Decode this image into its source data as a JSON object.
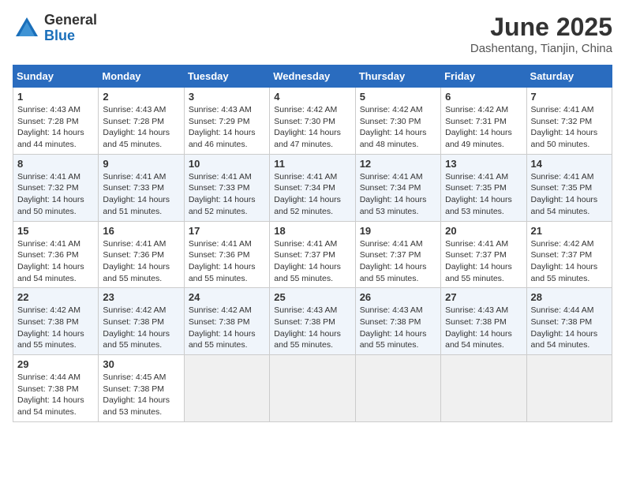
{
  "logo": {
    "general": "General",
    "blue": "Blue"
  },
  "title": "June 2025",
  "subtitle": "Dashentang, Tianjin, China",
  "days_of_week": [
    "Sunday",
    "Monday",
    "Tuesday",
    "Wednesday",
    "Thursday",
    "Friday",
    "Saturday"
  ],
  "weeks": [
    [
      {
        "day": "1",
        "info": "Sunrise: 4:43 AM\nSunset: 7:28 PM\nDaylight: 14 hours\nand 44 minutes."
      },
      {
        "day": "2",
        "info": "Sunrise: 4:43 AM\nSunset: 7:28 PM\nDaylight: 14 hours\nand 45 minutes."
      },
      {
        "day": "3",
        "info": "Sunrise: 4:43 AM\nSunset: 7:29 PM\nDaylight: 14 hours\nand 46 minutes."
      },
      {
        "day": "4",
        "info": "Sunrise: 4:42 AM\nSunset: 7:30 PM\nDaylight: 14 hours\nand 47 minutes."
      },
      {
        "day": "5",
        "info": "Sunrise: 4:42 AM\nSunset: 7:30 PM\nDaylight: 14 hours\nand 48 minutes."
      },
      {
        "day": "6",
        "info": "Sunrise: 4:42 AM\nSunset: 7:31 PM\nDaylight: 14 hours\nand 49 minutes."
      },
      {
        "day": "7",
        "info": "Sunrise: 4:41 AM\nSunset: 7:32 PM\nDaylight: 14 hours\nand 50 minutes."
      }
    ],
    [
      {
        "day": "8",
        "info": "Sunrise: 4:41 AM\nSunset: 7:32 PM\nDaylight: 14 hours\nand 50 minutes."
      },
      {
        "day": "9",
        "info": "Sunrise: 4:41 AM\nSunset: 7:33 PM\nDaylight: 14 hours\nand 51 minutes."
      },
      {
        "day": "10",
        "info": "Sunrise: 4:41 AM\nSunset: 7:33 PM\nDaylight: 14 hours\nand 52 minutes."
      },
      {
        "day": "11",
        "info": "Sunrise: 4:41 AM\nSunset: 7:34 PM\nDaylight: 14 hours\nand 52 minutes."
      },
      {
        "day": "12",
        "info": "Sunrise: 4:41 AM\nSunset: 7:34 PM\nDaylight: 14 hours\nand 53 minutes."
      },
      {
        "day": "13",
        "info": "Sunrise: 4:41 AM\nSunset: 7:35 PM\nDaylight: 14 hours\nand 53 minutes."
      },
      {
        "day": "14",
        "info": "Sunrise: 4:41 AM\nSunset: 7:35 PM\nDaylight: 14 hours\nand 54 minutes."
      }
    ],
    [
      {
        "day": "15",
        "info": "Sunrise: 4:41 AM\nSunset: 7:36 PM\nDaylight: 14 hours\nand 54 minutes."
      },
      {
        "day": "16",
        "info": "Sunrise: 4:41 AM\nSunset: 7:36 PM\nDaylight: 14 hours\nand 55 minutes."
      },
      {
        "day": "17",
        "info": "Sunrise: 4:41 AM\nSunset: 7:36 PM\nDaylight: 14 hours\nand 55 minutes."
      },
      {
        "day": "18",
        "info": "Sunrise: 4:41 AM\nSunset: 7:37 PM\nDaylight: 14 hours\nand 55 minutes."
      },
      {
        "day": "19",
        "info": "Sunrise: 4:41 AM\nSunset: 7:37 PM\nDaylight: 14 hours\nand 55 minutes."
      },
      {
        "day": "20",
        "info": "Sunrise: 4:41 AM\nSunset: 7:37 PM\nDaylight: 14 hours\nand 55 minutes."
      },
      {
        "day": "21",
        "info": "Sunrise: 4:42 AM\nSunset: 7:37 PM\nDaylight: 14 hours\nand 55 minutes."
      }
    ],
    [
      {
        "day": "22",
        "info": "Sunrise: 4:42 AM\nSunset: 7:38 PM\nDaylight: 14 hours\nand 55 minutes."
      },
      {
        "day": "23",
        "info": "Sunrise: 4:42 AM\nSunset: 7:38 PM\nDaylight: 14 hours\nand 55 minutes."
      },
      {
        "day": "24",
        "info": "Sunrise: 4:42 AM\nSunset: 7:38 PM\nDaylight: 14 hours\nand 55 minutes."
      },
      {
        "day": "25",
        "info": "Sunrise: 4:43 AM\nSunset: 7:38 PM\nDaylight: 14 hours\nand 55 minutes."
      },
      {
        "day": "26",
        "info": "Sunrise: 4:43 AM\nSunset: 7:38 PM\nDaylight: 14 hours\nand 55 minutes."
      },
      {
        "day": "27",
        "info": "Sunrise: 4:43 AM\nSunset: 7:38 PM\nDaylight: 14 hours\nand 54 minutes."
      },
      {
        "day": "28",
        "info": "Sunrise: 4:44 AM\nSunset: 7:38 PM\nDaylight: 14 hours\nand 54 minutes."
      }
    ],
    [
      {
        "day": "29",
        "info": "Sunrise: 4:44 AM\nSunset: 7:38 PM\nDaylight: 14 hours\nand 54 minutes."
      },
      {
        "day": "30",
        "info": "Sunrise: 4:45 AM\nSunset: 7:38 PM\nDaylight: 14 hours\nand 53 minutes."
      },
      {
        "day": "",
        "info": ""
      },
      {
        "day": "",
        "info": ""
      },
      {
        "day": "",
        "info": ""
      },
      {
        "day": "",
        "info": ""
      },
      {
        "day": "",
        "info": ""
      }
    ]
  ]
}
